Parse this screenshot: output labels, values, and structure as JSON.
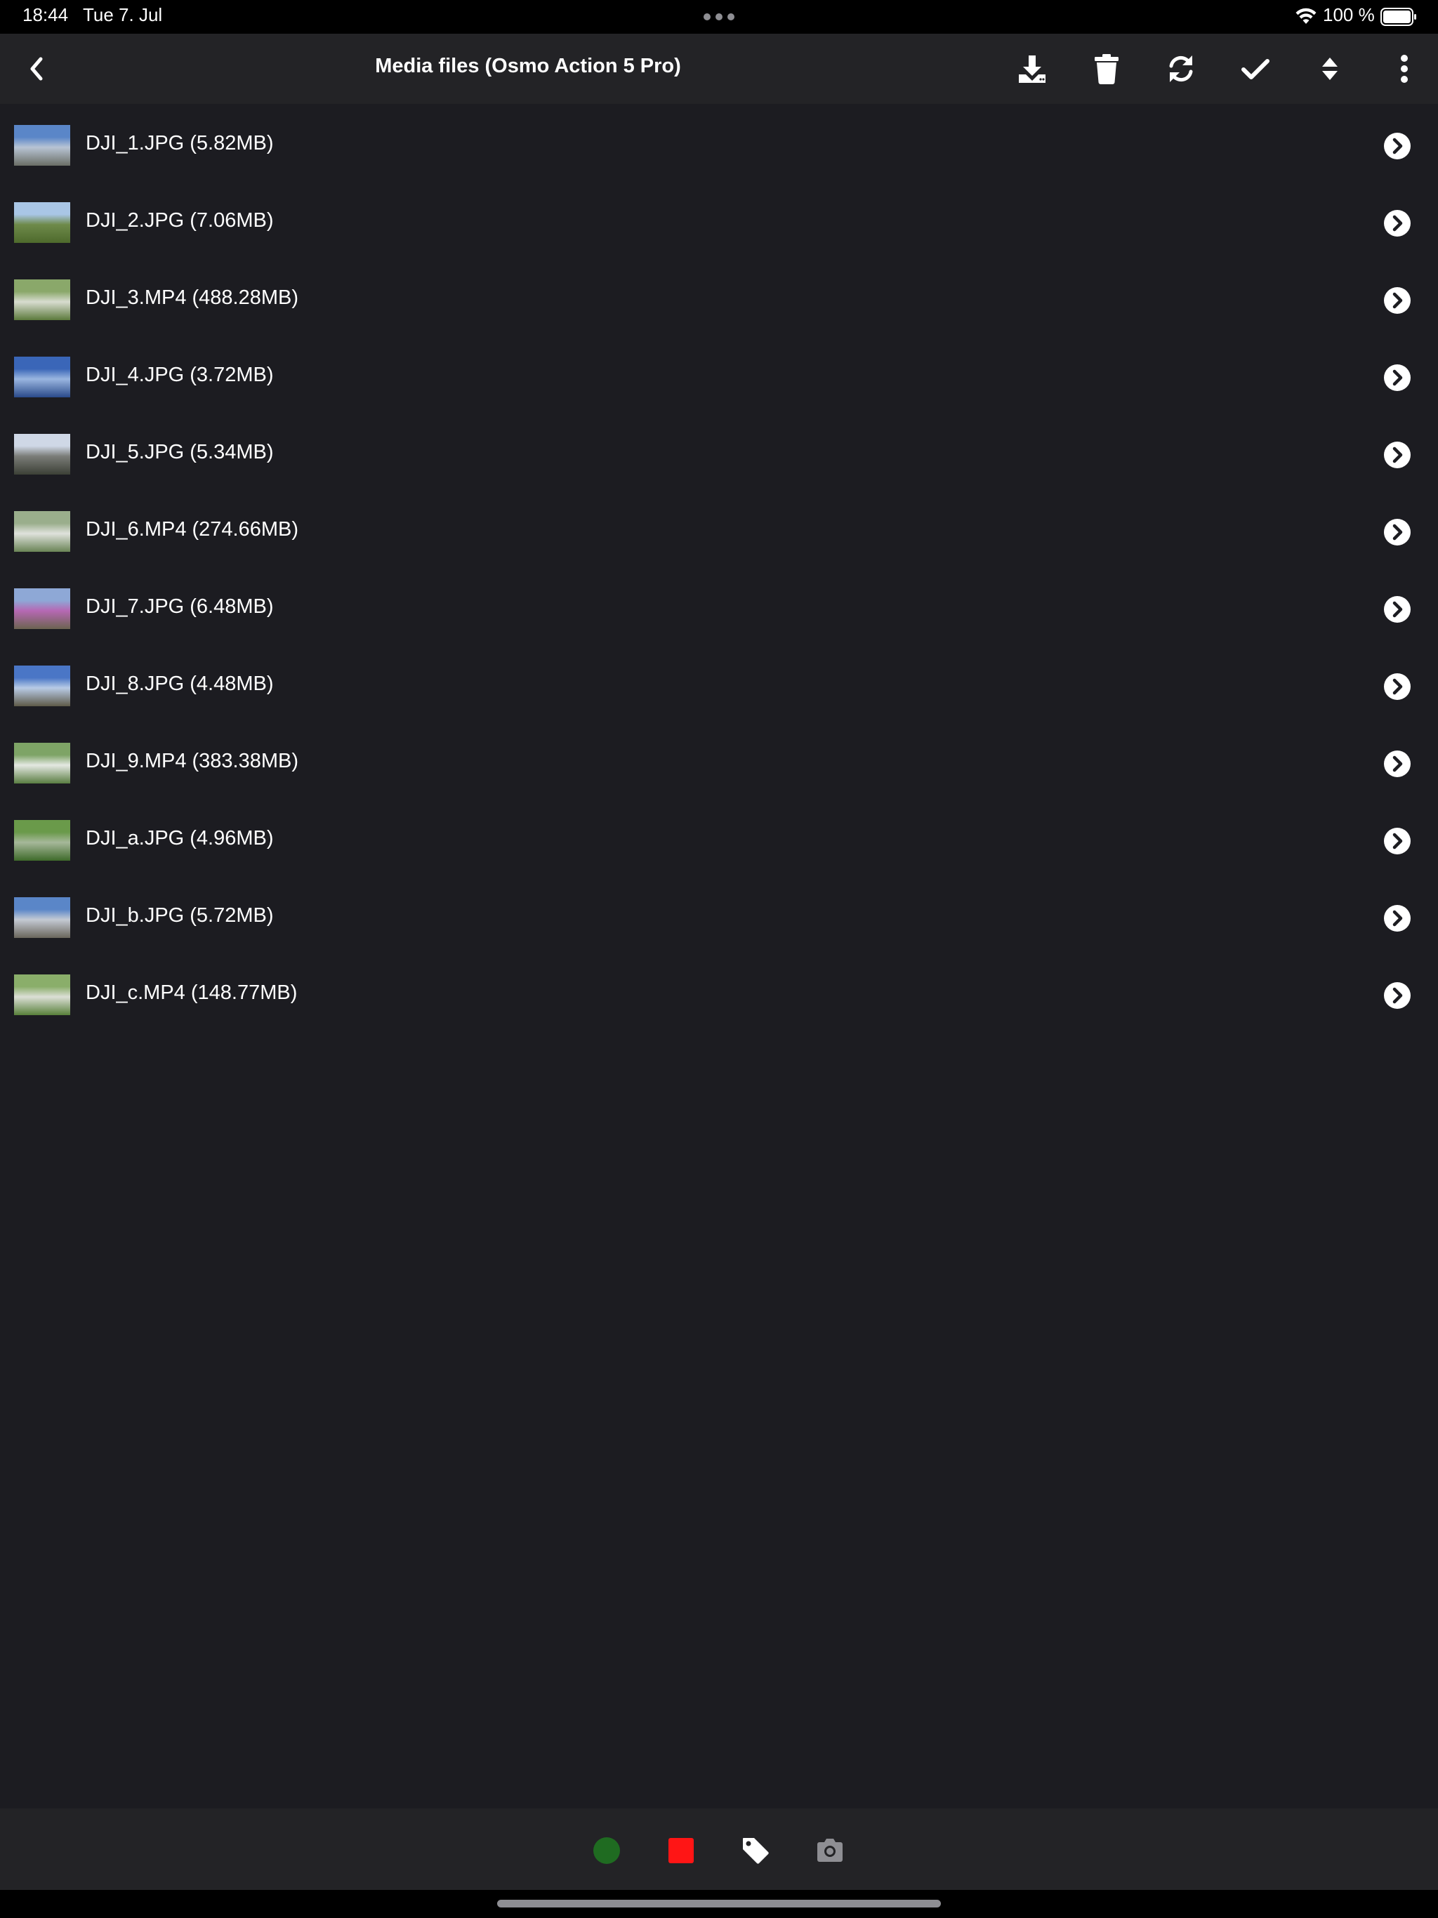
{
  "status_bar": {
    "time": "18:44",
    "date": "Tue 7. Jul",
    "battery_percent": "100 %",
    "wifi_icon": "wifi-icon",
    "battery_icon": "battery-full-icon"
  },
  "toolbar": {
    "title": "Media files (Osmo Action 5 Pro)",
    "back_icon": "chevron-left-icon",
    "actions": [
      "download-icon",
      "trash-icon",
      "refresh-icon",
      "checkmark-icon",
      "sort-icon",
      "more-vertical-icon"
    ]
  },
  "files": [
    {
      "label": "DJI_1.JPG (5.82MB)",
      "thumb_colors": [
        "#5a86c8",
        "#b8c4d4",
        "#6a6e66"
      ]
    },
    {
      "label": "DJI_2.JPG (7.06MB)",
      "thumb_colors": [
        "#a9c6e6",
        "#6e8a4a",
        "#4e6a2c"
      ]
    },
    {
      "label": "DJI_3.MP4 (488.28MB)",
      "thumb_colors": [
        "#8aa86a",
        "#d8dcd0",
        "#5c7a3c"
      ]
    },
    {
      "label": "DJI_4.JPG (3.72MB)",
      "thumb_colors": [
        "#3a66b8",
        "#9ab6e0",
        "#2a4a8a"
      ]
    },
    {
      "label": "DJI_5.JPG (5.34MB)",
      "thumb_colors": [
        "#cfd8e6",
        "#7a7c78",
        "#3c4036"
      ]
    },
    {
      "label": "DJI_6.MP4 (274.66MB)",
      "thumb_colors": [
        "#9aae8c",
        "#dfe2dc",
        "#6a8456"
      ]
    },
    {
      "label": "DJI_7.JPG (6.48MB)",
      "thumb_colors": [
        "#8ea8d6",
        "#b668b4",
        "#6c6450"
      ]
    },
    {
      "label": "DJI_8.JPG (4.48MB)",
      "thumb_colors": [
        "#4a76c6",
        "#b8cbe6",
        "#5e5a48"
      ]
    },
    {
      "label": "DJI_9.MP4 (383.38MB)",
      "thumb_colors": [
        "#7ea466",
        "#e4e8e2",
        "#5a7e42"
      ]
    },
    {
      "label": "DJI_a.JPG (4.96MB)",
      "thumb_colors": [
        "#6a9a4a",
        "#a6b89a",
        "#3e6a2a"
      ]
    },
    {
      "label": "DJI_b.JPG (5.72MB)",
      "thumb_colors": [
        "#5a86c8",
        "#c4cad4",
        "#6a665c"
      ]
    },
    {
      "label": "DJI_c.MP4 (148.77MB)",
      "thumb_colors": [
        "#8aae6a",
        "#dcdfd6",
        "#58803a"
      ]
    }
  ],
  "row_action_icon": "chevron-circle-right-icon",
  "bottom_bar": {
    "buttons": [
      "record-status-icon",
      "stop-icon",
      "tag-icon",
      "camera-icon"
    ],
    "colors": {
      "record": "#1f6b21",
      "stop": "#ff1515",
      "tag": "#ffffff",
      "camera": "#8e8e93"
    }
  }
}
